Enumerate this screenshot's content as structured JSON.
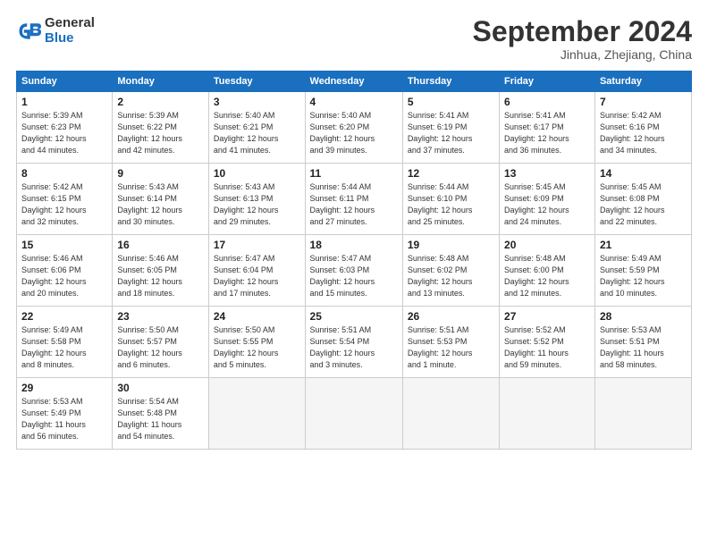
{
  "logo": {
    "line1": "General",
    "line2": "Blue"
  },
  "title": "September 2024",
  "subtitle": "Jinhua, Zhejiang, China",
  "weekdays": [
    "Sunday",
    "Monday",
    "Tuesday",
    "Wednesday",
    "Thursday",
    "Friday",
    "Saturday"
  ],
  "weeks": [
    [
      {
        "day": "1",
        "info": "Sunrise: 5:39 AM\nSunset: 6:23 PM\nDaylight: 12 hours\nand 44 minutes."
      },
      {
        "day": "2",
        "info": "Sunrise: 5:39 AM\nSunset: 6:22 PM\nDaylight: 12 hours\nand 42 minutes."
      },
      {
        "day": "3",
        "info": "Sunrise: 5:40 AM\nSunset: 6:21 PM\nDaylight: 12 hours\nand 41 minutes."
      },
      {
        "day": "4",
        "info": "Sunrise: 5:40 AM\nSunset: 6:20 PM\nDaylight: 12 hours\nand 39 minutes."
      },
      {
        "day": "5",
        "info": "Sunrise: 5:41 AM\nSunset: 6:19 PM\nDaylight: 12 hours\nand 37 minutes."
      },
      {
        "day": "6",
        "info": "Sunrise: 5:41 AM\nSunset: 6:17 PM\nDaylight: 12 hours\nand 36 minutes."
      },
      {
        "day": "7",
        "info": "Sunrise: 5:42 AM\nSunset: 6:16 PM\nDaylight: 12 hours\nand 34 minutes."
      }
    ],
    [
      {
        "day": "8",
        "info": "Sunrise: 5:42 AM\nSunset: 6:15 PM\nDaylight: 12 hours\nand 32 minutes."
      },
      {
        "day": "9",
        "info": "Sunrise: 5:43 AM\nSunset: 6:14 PM\nDaylight: 12 hours\nand 30 minutes."
      },
      {
        "day": "10",
        "info": "Sunrise: 5:43 AM\nSunset: 6:13 PM\nDaylight: 12 hours\nand 29 minutes."
      },
      {
        "day": "11",
        "info": "Sunrise: 5:44 AM\nSunset: 6:11 PM\nDaylight: 12 hours\nand 27 minutes."
      },
      {
        "day": "12",
        "info": "Sunrise: 5:44 AM\nSunset: 6:10 PM\nDaylight: 12 hours\nand 25 minutes."
      },
      {
        "day": "13",
        "info": "Sunrise: 5:45 AM\nSunset: 6:09 PM\nDaylight: 12 hours\nand 24 minutes."
      },
      {
        "day": "14",
        "info": "Sunrise: 5:45 AM\nSunset: 6:08 PM\nDaylight: 12 hours\nand 22 minutes."
      }
    ],
    [
      {
        "day": "15",
        "info": "Sunrise: 5:46 AM\nSunset: 6:06 PM\nDaylight: 12 hours\nand 20 minutes."
      },
      {
        "day": "16",
        "info": "Sunrise: 5:46 AM\nSunset: 6:05 PM\nDaylight: 12 hours\nand 18 minutes."
      },
      {
        "day": "17",
        "info": "Sunrise: 5:47 AM\nSunset: 6:04 PM\nDaylight: 12 hours\nand 17 minutes."
      },
      {
        "day": "18",
        "info": "Sunrise: 5:47 AM\nSunset: 6:03 PM\nDaylight: 12 hours\nand 15 minutes."
      },
      {
        "day": "19",
        "info": "Sunrise: 5:48 AM\nSunset: 6:02 PM\nDaylight: 12 hours\nand 13 minutes."
      },
      {
        "day": "20",
        "info": "Sunrise: 5:48 AM\nSunset: 6:00 PM\nDaylight: 12 hours\nand 12 minutes."
      },
      {
        "day": "21",
        "info": "Sunrise: 5:49 AM\nSunset: 5:59 PM\nDaylight: 12 hours\nand 10 minutes."
      }
    ],
    [
      {
        "day": "22",
        "info": "Sunrise: 5:49 AM\nSunset: 5:58 PM\nDaylight: 12 hours\nand 8 minutes."
      },
      {
        "day": "23",
        "info": "Sunrise: 5:50 AM\nSunset: 5:57 PM\nDaylight: 12 hours\nand 6 minutes."
      },
      {
        "day": "24",
        "info": "Sunrise: 5:50 AM\nSunset: 5:55 PM\nDaylight: 12 hours\nand 5 minutes."
      },
      {
        "day": "25",
        "info": "Sunrise: 5:51 AM\nSunset: 5:54 PM\nDaylight: 12 hours\nand 3 minutes."
      },
      {
        "day": "26",
        "info": "Sunrise: 5:51 AM\nSunset: 5:53 PM\nDaylight: 12 hours\nand 1 minute."
      },
      {
        "day": "27",
        "info": "Sunrise: 5:52 AM\nSunset: 5:52 PM\nDaylight: 11 hours\nand 59 minutes."
      },
      {
        "day": "28",
        "info": "Sunrise: 5:53 AM\nSunset: 5:51 PM\nDaylight: 11 hours\nand 58 minutes."
      }
    ],
    [
      {
        "day": "29",
        "info": "Sunrise: 5:53 AM\nSunset: 5:49 PM\nDaylight: 11 hours\nand 56 minutes."
      },
      {
        "day": "30",
        "info": "Sunrise: 5:54 AM\nSunset: 5:48 PM\nDaylight: 11 hours\nand 54 minutes."
      },
      {
        "day": "",
        "info": ""
      },
      {
        "day": "",
        "info": ""
      },
      {
        "day": "",
        "info": ""
      },
      {
        "day": "",
        "info": ""
      },
      {
        "day": "",
        "info": ""
      }
    ]
  ]
}
